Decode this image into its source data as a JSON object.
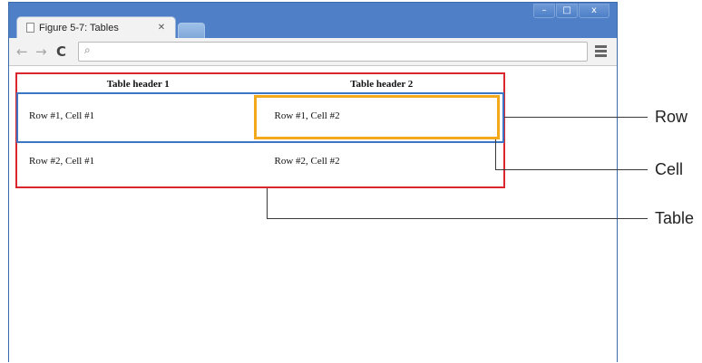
{
  "window": {
    "title": "Figure 5-7: Tables",
    "controls": {
      "minimize": "–",
      "maximize": "□",
      "close": "x"
    }
  },
  "toolbar": {
    "back_icon": "←",
    "forward_icon": "→",
    "reload_icon": "C",
    "search_icon": "search-icon",
    "menu_icon": "menu-icon",
    "address_value": ""
  },
  "table": {
    "headers": [
      "Table header 1",
      "Table header 2"
    ],
    "rows": [
      [
        "Row #1, Cell #1",
        "Row #1, Cell #2"
      ],
      [
        "Row #2, Cell #1",
        "Row #2, Cell #2"
      ]
    ]
  },
  "callouts": {
    "row": "Row",
    "cell": "Cell",
    "table": "Table"
  },
  "colors": {
    "table_outline": "#d9272d",
    "row_outline": "#3d74c4",
    "cell_outline": "#f2a91c",
    "window_frame": "#4f7fc6"
  }
}
